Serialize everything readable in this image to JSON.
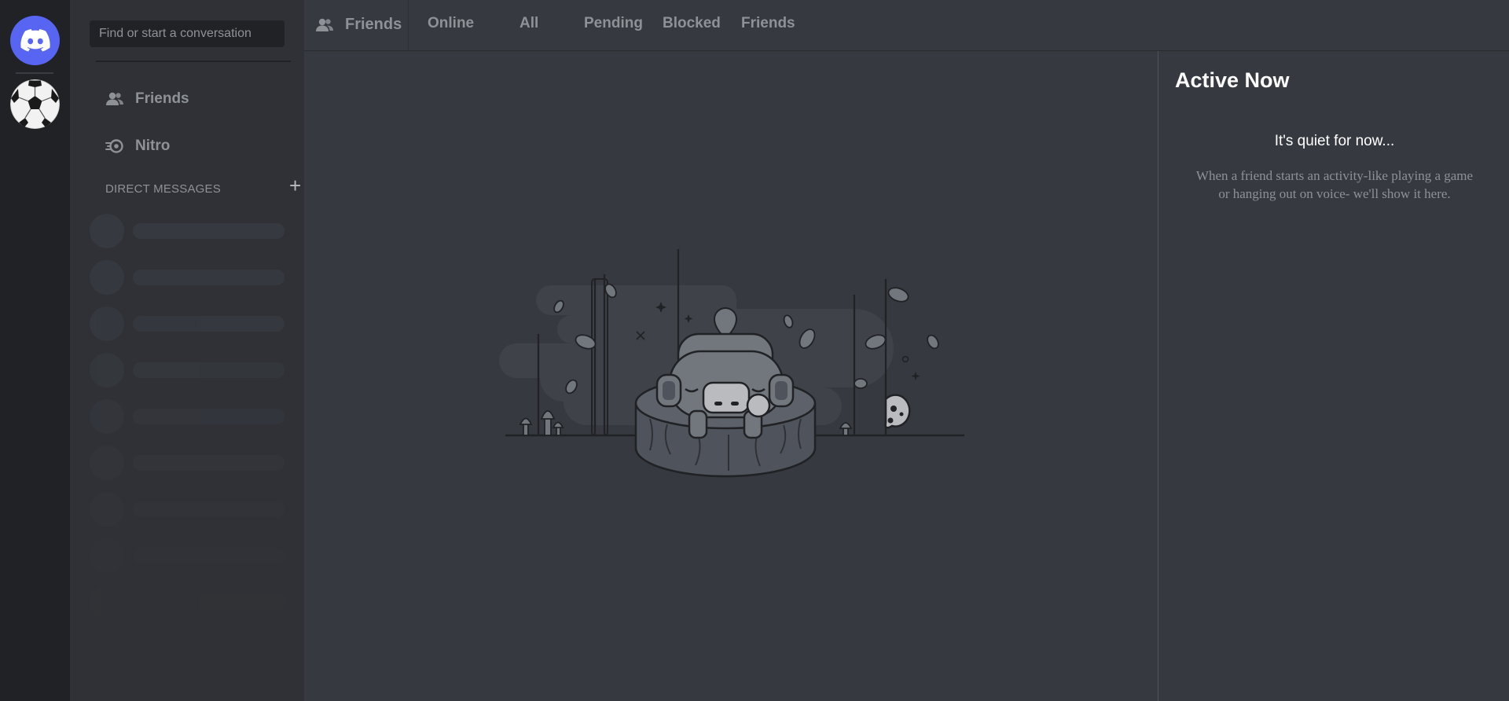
{
  "search": {
    "placeholder": "Find or start a conversation"
  },
  "sidebar": {
    "items": [
      {
        "label": "Friends",
        "icon": "friends-icon"
      },
      {
        "label": "Nitro",
        "icon": "nitro-icon"
      }
    ],
    "dm_header": "DIRECT MESSAGES"
  },
  "header": {
    "title": "Friends",
    "tabs": [
      "Online",
      "All",
      "Pending",
      "Blocked",
      "Friends"
    ]
  },
  "active_now": {
    "title": "Active Now",
    "quiet": "It's quiet for now...",
    "description": "When a friend starts an activity-like playing a game or hanging out on voice- we'll show it here."
  },
  "colors": {
    "blurple": "#5865f2",
    "guild_bar": "#202225",
    "sidebar": "#2f3136",
    "main": "#36393f",
    "muted_text": "#8e9297"
  }
}
